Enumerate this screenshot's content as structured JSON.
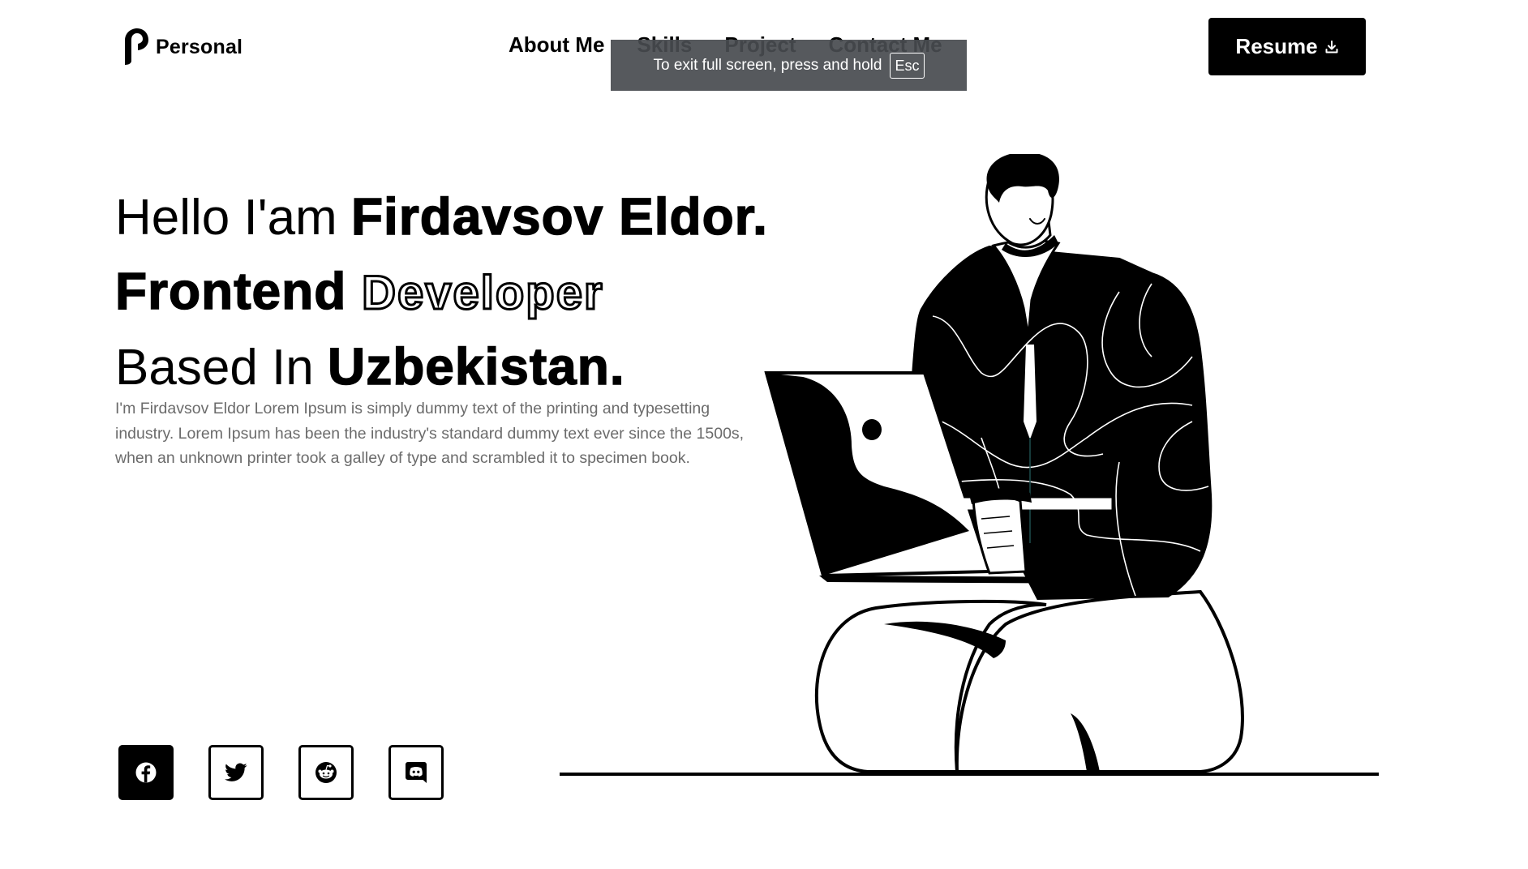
{
  "brand": {
    "name": "Personal",
    "icon": "p-logo-icon"
  },
  "nav": {
    "items": [
      {
        "label": "About Me"
      },
      {
        "label": "Skills"
      },
      {
        "label": "Project"
      },
      {
        "label": "Contact Me"
      }
    ]
  },
  "resume_button": {
    "label": "Resume",
    "icon": "download-icon"
  },
  "fullscreen_notice": {
    "text": "To exit full screen, press and hold",
    "key": "Esc"
  },
  "hero": {
    "line1_light": "Hello I'am ",
    "line1_bold": "Firdavsov Eldor.",
    "line2_bold": "Frontend ",
    "line2_outline": "Developer",
    "line3_light": "Based In ",
    "line3_bold": "Uzbekistan.",
    "description": "I'm Firdavsov Eldor Lorem Ipsum is simply dummy text of the printing and typesetting industry. Lorem Ipsum has been the industry's standard dummy text ever since the 1500s, when an unknown printer took a galley of type and scrambled it to specimen book."
  },
  "socials": [
    {
      "icon": "facebook-icon",
      "active": true
    },
    {
      "icon": "twitter-icon",
      "active": false
    },
    {
      "icon": "reddit-icon",
      "active": false
    },
    {
      "icon": "discord-icon",
      "active": false
    }
  ],
  "colors": {
    "primary": "#000000",
    "background": "#ffffff",
    "muted_text": "#6b6b6b",
    "toast_bg": "#484b4f"
  }
}
